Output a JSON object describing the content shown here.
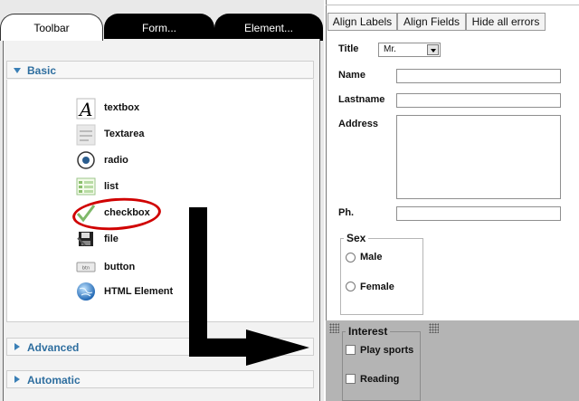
{
  "tabs": [
    {
      "label": "Toolbar"
    },
    {
      "label": "Form..."
    },
    {
      "label": "Element..."
    }
  ],
  "accordion": {
    "basic": "Basic",
    "advanced": "Advanced",
    "automatic": "Automatic"
  },
  "toolbox_items": [
    {
      "label": "textbox",
      "icon": "textbox-icon"
    },
    {
      "label": "Textarea",
      "icon": "textarea-icon"
    },
    {
      "label": "radio",
      "icon": "radio-icon"
    },
    {
      "label": "list",
      "icon": "list-icon"
    },
    {
      "label": "checkbox",
      "icon": "checkbox-icon"
    },
    {
      "label": "file",
      "icon": "file-icon"
    },
    {
      "label": "button",
      "icon": "button-icon"
    },
    {
      "label": "HTML Element",
      "icon": "html-element-icon"
    }
  ],
  "button_icon_text": "btn",
  "form_toolbar": {
    "align_labels": "Align Labels",
    "align_fields": "Align Fields",
    "hide_errors": "Hide all errors"
  },
  "form": {
    "title_label": "Title",
    "title_value": "Mr.",
    "name_label": "Name",
    "lastname_label": "Lastname",
    "address_label": "Address",
    "phone_label": "Ph.",
    "sex_legend": "Sex",
    "sex_options": [
      "Male",
      "Female"
    ],
    "interest_legend": "Interest",
    "interest_options": [
      "Play sports",
      "Reading"
    ]
  },
  "colors": {
    "accent": "#2e6e9f",
    "annotation": "#d00000",
    "drop_zone": "#b4b4b4"
  }
}
